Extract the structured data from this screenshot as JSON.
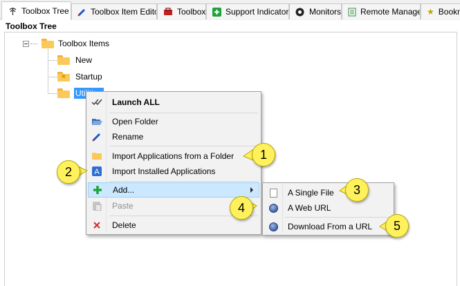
{
  "tabs": [
    {
      "label": "Toolbox Tree",
      "icon": "tree-icon",
      "active": true
    },
    {
      "label": "Toolbox Item Editor",
      "icon": "pencil-icon",
      "active": false
    },
    {
      "label": "Toolbox",
      "icon": "toolbox-icon",
      "active": false
    },
    {
      "label": "Support Indicators",
      "icon": "plus-icon",
      "active": false
    },
    {
      "label": "Monitors",
      "icon": "monitor-icon",
      "active": false
    },
    {
      "label": "Remote Manager",
      "icon": "document-icon",
      "active": false
    },
    {
      "label": "Bookm",
      "icon": "star-icon",
      "active": false
    }
  ],
  "panel": {
    "title": "Toolbox Tree"
  },
  "tree": {
    "root": {
      "label": "Toolbox Items"
    },
    "children": [
      {
        "label": "New",
        "icon": "folder-icon"
      },
      {
        "label": "Startup",
        "icon": "star-folder-icon"
      },
      {
        "label": "Utilities",
        "icon": "folder-icon",
        "selected": true
      }
    ]
  },
  "context_menu": {
    "items": [
      {
        "label": "Launch ALL",
        "icon": "double-check-icon",
        "bold": true
      },
      {
        "label": "Open Folder",
        "icon": "open-folder-icon"
      },
      {
        "label": "Rename",
        "icon": "pencil-icon"
      },
      {
        "label": "Import Applications from a Folder",
        "icon": "folder-icon"
      },
      {
        "label": "Import Installed Applications",
        "icon": "app-letter-icon"
      },
      {
        "label": "Add...",
        "icon": "green-plus-icon",
        "highlighted": true,
        "has_submenu": true
      },
      {
        "label": "Paste",
        "icon": "paste-icon",
        "disabled": true
      },
      {
        "label": "Delete",
        "icon": "red-x-icon"
      }
    ]
  },
  "submenu": {
    "items": [
      {
        "label": "A Single File",
        "icon": "file-icon"
      },
      {
        "label": "A Web URL",
        "icon": "globe-icon"
      },
      {
        "label": "Download From a URL",
        "icon": "globe-icon"
      }
    ]
  },
  "callouts": [
    "1",
    "2",
    "3",
    "4",
    "5"
  ],
  "colors": {
    "callout_fill": "#fff15c",
    "selection": "#3399ff",
    "menu_highlight": "#cce8ff"
  }
}
